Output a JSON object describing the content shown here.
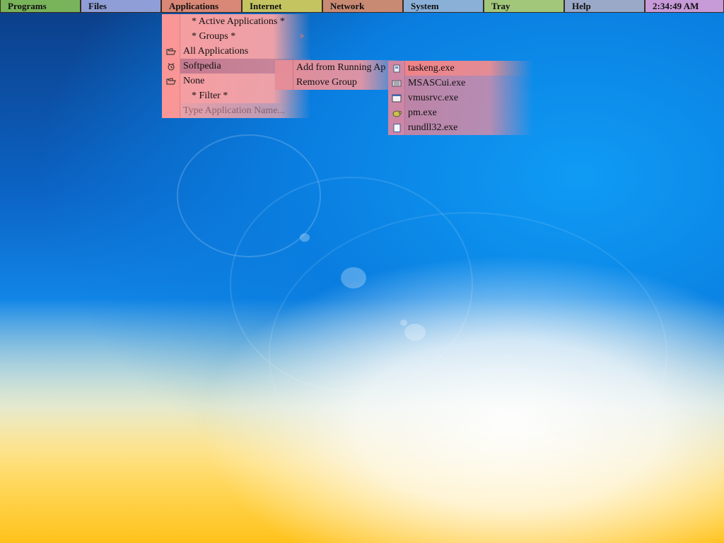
{
  "topbar": {
    "items": [
      {
        "label": "Programs",
        "color": "#79b35a"
      },
      {
        "label": "Files",
        "color": "#8f9ed6"
      },
      {
        "label": "Applications",
        "color": "#d98776"
      },
      {
        "label": "Internet",
        "color": "#c4c461"
      },
      {
        "label": "Network",
        "color": "#c98a74"
      },
      {
        "label": "System",
        "color": "#8ab0d8"
      },
      {
        "label": "Tray",
        "color": "#a2c77a"
      },
      {
        "label": "Help",
        "color": "#9aa9c8"
      }
    ],
    "clock": {
      "label": "2:34:49 AM",
      "color": "#c79ad8"
    }
  },
  "apps_menu": {
    "active_header": "* Active Applications *",
    "groups_header": "* Groups *",
    "all_applications": "All Applications",
    "softpedia": "Softpedia",
    "none": "None",
    "filter_header": "* Filter *",
    "search_placeholder": "Type Application Name..."
  },
  "group_submenu": {
    "add_from_running": "Add from Running Ap",
    "remove_group": "Remove Group"
  },
  "running_menu": {
    "items": [
      {
        "label": "taskeng.exe",
        "icon": "task-scheduler-icon"
      },
      {
        "label": "MSASCui.exe",
        "icon": "defender-icon"
      },
      {
        "label": "vmusrvc.exe",
        "icon": "window-app-icon"
      },
      {
        "label": "pm.exe",
        "icon": "turtle-icon"
      },
      {
        "label": "rundll32.exe",
        "icon": "document-icon"
      }
    ]
  }
}
